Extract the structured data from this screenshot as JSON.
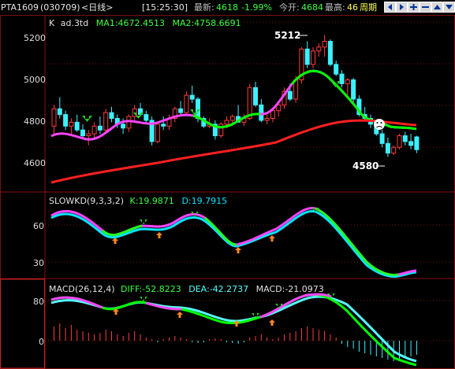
{
  "header": {
    "symbol": "PTA1609",
    "code": "(030709)",
    "period": "<日线>",
    "time": "[15:25:30]",
    "last_label": "最新:",
    "last": "4618",
    "change_pct": "-1.99%",
    "open_label": "今开:",
    "open": "4684",
    "high_label": "最高:",
    "high": "46",
    "cycle_tab": "周期",
    "buttons": [
      "arrow-left-icon",
      "arrow-right-icon",
      "zoom-in-icon",
      "zoom-out-icon",
      "arrow-up-icon",
      "arrow-down-icon"
    ]
  },
  "colors": {
    "up": "#ff3c3c",
    "down": "#3cf0ff",
    "ma1": "#ff44ff",
    "ma1_alt": "#00ff00",
    "ma2": "#ff2020",
    "k": "#ff44ff",
    "k_alt": "#22ff22",
    "d": "#00e6ff",
    "diff": "#00ff00",
    "dea": "#55ffff",
    "grid": "#7a1010"
  },
  "main": {
    "title": "K",
    "indicator": "ad.3td",
    "ma1_label": "MA1:4672.4513",
    "ma2_label": "MA2:4758.6691",
    "y_ticks": [
      "5200",
      "5000",
      "4800",
      "4600"
    ],
    "high_mark": "5212",
    "low_mark": "4580"
  },
  "kd": {
    "label": "SLOWKD(9,3,3,2)",
    "k_label": "K:19.9871",
    "d_label": "D:19.7915",
    "y_ticks": [
      "60",
      "30"
    ]
  },
  "macd": {
    "label": "MACD(26,12,4)",
    "diff_label": "DIFF:-52.8223",
    "dea_label": "DEA:-42.2737",
    "macd_label": "MACD:-21.0973",
    "y_ticks": [
      "80",
      "0"
    ]
  },
  "chart_data": {
    "type": "candlestick",
    "ylim": [
      4480,
      5280
    ],
    "candles": [
      [
        4740,
        4850,
        4700,
        4830
      ],
      [
        4830,
        4890,
        4780,
        4800
      ],
      [
        4800,
        4820,
        4720,
        4740
      ],
      [
        4740,
        4780,
        4700,
        4760
      ],
      [
        4760,
        4800,
        4710,
        4720
      ],
      [
        4720,
        4750,
        4680,
        4690
      ],
      [
        4690,
        4720,
        4640,
        4700
      ],
      [
        4700,
        4760,
        4680,
        4740
      ],
      [
        4740,
        4790,
        4700,
        4720
      ],
      [
        4720,
        4830,
        4700,
        4810
      ],
      [
        4810,
        4840,
        4760,
        4780
      ],
      [
        4780,
        4800,
        4730,
        4750
      ],
      [
        4750,
        4780,
        4700,
        4730
      ],
      [
        4730,
        4800,
        4710,
        4790
      ],
      [
        4790,
        4850,
        4770,
        4830
      ],
      [
        4830,
        4860,
        4790,
        4800
      ],
      [
        4800,
        4820,
        4760,
        4770
      ],
      [
        4770,
        4790,
        4640,
        4660
      ],
      [
        4660,
        4760,
        4650,
        4750
      ],
      [
        4750,
        4790,
        4720,
        4740
      ],
      [
        4740,
        4800,
        4720,
        4780
      ],
      [
        4780,
        4840,
        4760,
        4830
      ],
      [
        4830,
        4870,
        4800,
        4810
      ],
      [
        4810,
        4920,
        4800,
        4900
      ],
      [
        4900,
        4950,
        4860,
        4880
      ],
      [
        4880,
        4890,
        4760,
        4780
      ],
      [
        4780,
        4790,
        4730,
        4740
      ],
      [
        4740,
        4780,
        4730,
        4750
      ],
      [
        4750,
        4770,
        4670,
        4690
      ],
      [
        4690,
        4760,
        4680,
        4750
      ],
      [
        4750,
        4790,
        4730,
        4770
      ],
      [
        4770,
        4800,
        4740,
        4790
      ],
      [
        4790,
        4850,
        4760,
        4760
      ],
      [
        4760,
        4800,
        4740,
        4780
      ],
      [
        4780,
        4960,
        4770,
        4940
      ],
      [
        4940,
        4970,
        4840,
        4850
      ],
      [
        4850,
        4880,
        4760,
        4770
      ],
      [
        4770,
        4800,
        4750,
        4780
      ],
      [
        4780,
        4830,
        4760,
        4820
      ],
      [
        4820,
        4860,
        4790,
        4850
      ],
      [
        4850,
        4940,
        4830,
        4920
      ],
      [
        4920,
        4960,
        4870,
        4880
      ],
      [
        4880,
        5000,
        4860,
        4980
      ],
      [
        4980,
        5150,
        4960,
        5140
      ],
      [
        5140,
        5180,
        5040,
        5060
      ],
      [
        5060,
        5150,
        5040,
        5130
      ],
      [
        5130,
        5170,
        5100,
        5150
      ],
      [
        5150,
        5212,
        5100,
        5180
      ],
      [
        5180,
        5190,
        5050,
        5060
      ],
      [
        5060,
        5080,
        5000,
        5010
      ],
      [
        5010,
        5030,
        4940,
        4960
      ],
      [
        4960,
        4990,
        4900,
        4980
      ],
      [
        4980,
        4990,
        4860,
        4880
      ],
      [
        4880,
        4900,
        4790,
        4800
      ],
      [
        4800,
        4840,
        4770,
        4780
      ],
      [
        4780,
        4800,
        4730,
        4750
      ],
      [
        4750,
        4770,
        4690,
        4700
      ],
      [
        4700,
        4720,
        4630,
        4650
      ],
      [
        4650,
        4680,
        4580,
        4600
      ],
      [
        4600,
        4640,
        4590,
        4630
      ],
      [
        4630,
        4700,
        4620,
        4690
      ],
      [
        4690,
        4710,
        4640,
        4660
      ],
      [
        4660,
        4700,
        4620,
        4640
      ],
      [
        4684,
        4690,
        4600,
        4618
      ]
    ]
  }
}
